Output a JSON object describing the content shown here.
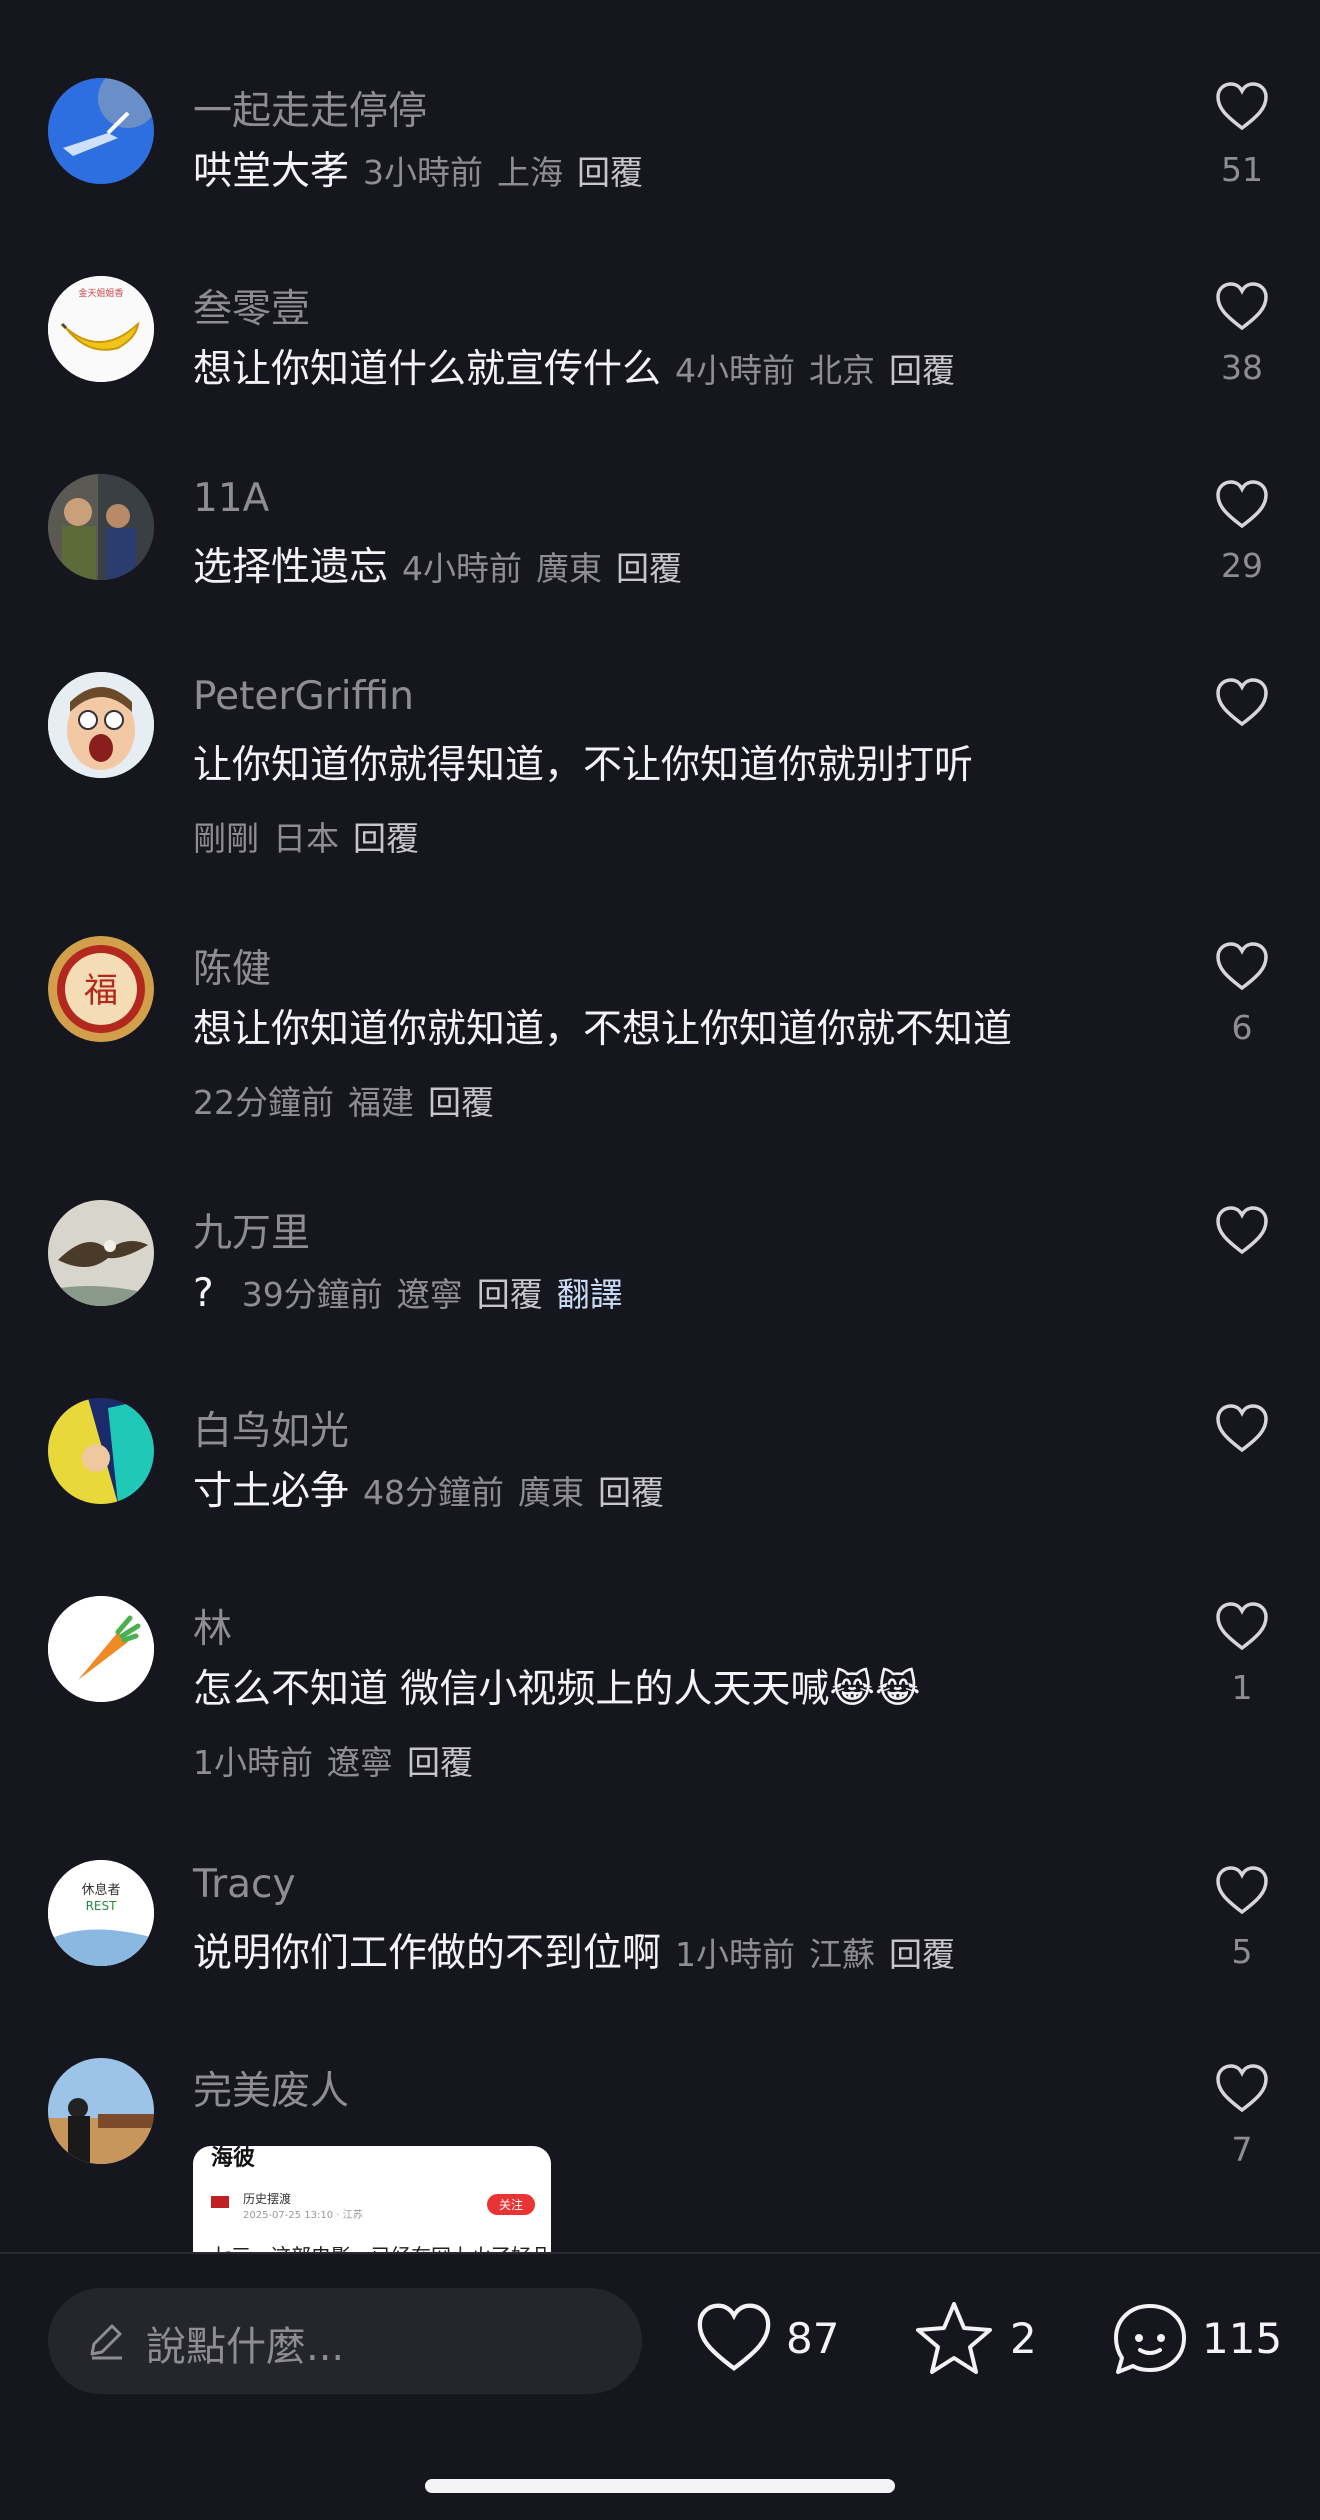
{
  "comments": [
    {
      "user": "一起走走停停",
      "text": "哄堂大孝",
      "time": "3小時前",
      "loc": "上海",
      "reply": "回覆",
      "likes": "51"
    },
    {
      "user": "叁零壹",
      "text": "想让你知道什么就宣传什么",
      "time": "4小時前",
      "loc": "北京",
      "reply": "回覆",
      "likes": "38"
    },
    {
      "user": "11A",
      "text": "选择性遗忘",
      "time": "4小時前",
      "loc": "廣東",
      "reply": "回覆",
      "likes": "29"
    },
    {
      "user": "PeterGriffin",
      "text": "让你知道你就得知道，不让你知道你就别打听",
      "time": "剛剛",
      "loc": "日本",
      "reply": "回覆",
      "likes": ""
    },
    {
      "user": "陈健",
      "text": "想让你知道你就知道，不想让你知道你就不知道",
      "time": "22分鐘前",
      "loc": "福建",
      "reply": "回覆",
      "likes": "6"
    },
    {
      "user": "九万里",
      "text": "?",
      "time": "39分鐘前",
      "loc": "遼寧",
      "reply": "回覆",
      "translate": "翻譯",
      "likes": ""
    },
    {
      "user": "白鸟如光",
      "text": "寸土必争",
      "time": "48分鐘前",
      "loc": "廣東",
      "reply": "回覆",
      "likes": ""
    },
    {
      "user": "林",
      "text": "怎么不知道 微信小视频上的人天天喊😹😹",
      "time": "1小時前",
      "loc": "遼寧",
      "reply": "回覆",
      "likes": "1"
    },
    {
      "user": "Tracy",
      "text": "说明你们工作做的不到位啊",
      "time": "1小時前",
      "loc": "江蘇",
      "reply": "回覆",
      "likes": "5"
    },
    {
      "user": "完美废人",
      "likes": "7"
    }
  ],
  "attachment": {
    "title": "海彼",
    "source": "历史摆渡",
    "follow": "关注",
    "meta": "2025-07-25 13:10 · 江苏",
    "body": "七三一这部电影，已经在网上火了好几年"
  },
  "avatar_text": {
    "banana": "金天姐姐香",
    "rest_line1": "休息者",
    "rest_line2": "REST",
    "seal": "福"
  },
  "bottom": {
    "placeholder": "說點什麼...",
    "likes": "87",
    "favorites": "2",
    "comments": "115"
  },
  "colors": {
    "background": "#16161e",
    "accent_text": "#c8dcf5",
    "muted": "#8d8d93"
  }
}
